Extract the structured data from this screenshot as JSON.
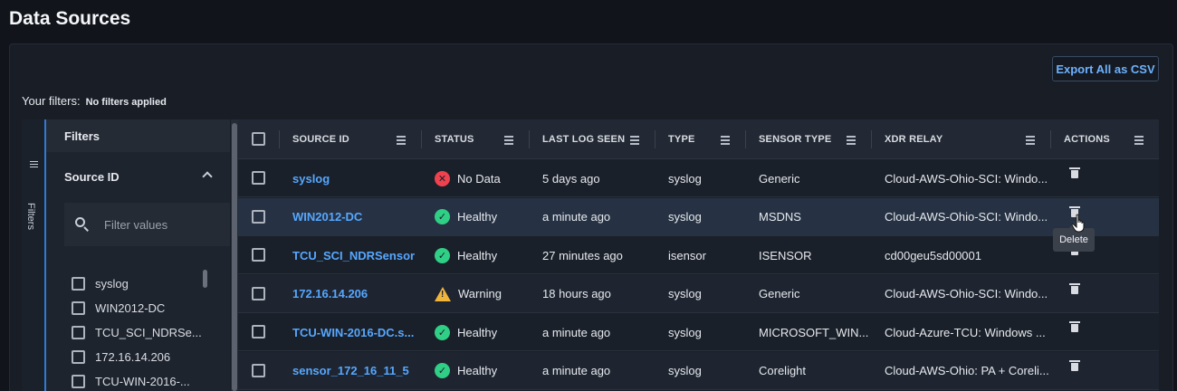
{
  "page": {
    "title": "Data Sources"
  },
  "toolbar": {
    "export_label": "Export All as CSV"
  },
  "filters": {
    "label": "Your filters:",
    "value": "No filters applied",
    "rail_label": "Filters",
    "panel_title": "Filters",
    "section_title": "Source ID",
    "search_placeholder": "Filter values",
    "options": [
      "syslog",
      "WIN2012-DC",
      "TCU_SCI_NDRSe...",
      "172.16.14.206",
      "TCU-WIN-2016-..."
    ]
  },
  "table": {
    "columns": [
      "SOURCE ID",
      "STATUS",
      "LAST LOG SEEN",
      "TYPE",
      "SENSOR TYPE",
      "XDR RELAY",
      "ACTIONS"
    ],
    "rows": [
      {
        "source_id": "syslog",
        "status": "No Data",
        "status_kind": "error",
        "last_log": "5 days ago",
        "type": "syslog",
        "sensor_type": "Generic",
        "relay": "Cloud-AWS-Ohio-SCI: Windo..."
      },
      {
        "source_id": "WIN2012-DC",
        "status": "Healthy",
        "status_kind": "healthy",
        "last_log": "a minute ago",
        "type": "syslog",
        "sensor_type": "MSDNS",
        "relay": "Cloud-AWS-Ohio-SCI: Windo..."
      },
      {
        "source_id": "TCU_SCI_NDRSensor",
        "status": "Healthy",
        "status_kind": "healthy",
        "last_log": "27 minutes ago",
        "type": "isensor",
        "sensor_type": "ISENSOR",
        "relay": "cd00geu5sd00001"
      },
      {
        "source_id": "172.16.14.206",
        "status": "Warning",
        "status_kind": "warning",
        "last_log": "18 hours ago",
        "type": "syslog",
        "sensor_type": "Generic",
        "relay": "Cloud-AWS-Ohio-SCI: Windo..."
      },
      {
        "source_id": "TCU-WIN-2016-DC.s...",
        "status": "Healthy",
        "status_kind": "healthy",
        "last_log": "a minute ago",
        "type": "syslog",
        "sensor_type": "MICROSOFT_WIN...",
        "relay": "Cloud-Azure-TCU: Windows ..."
      },
      {
        "source_id": "sensor_172_16_11_5",
        "status": "Healthy",
        "status_kind": "healthy",
        "last_log": "a minute ago",
        "type": "syslog",
        "sensor_type": "Corelight",
        "relay": "Cloud-AWS-Ohio: PA + Coreli..."
      }
    ]
  },
  "tooltip": {
    "text": "Delete"
  },
  "icons": {
    "row_action": "trash-icon",
    "column_menu": "menu-icon",
    "search": "search-icon",
    "collapse": "chevron-up-icon",
    "cursor": "hand-cursor-icon"
  },
  "colors": {
    "accent": "#56a7ff",
    "healthy": "#2fcf86",
    "error": "#f0424e",
    "warning": "#f2b53c",
    "background": "#11141a"
  }
}
